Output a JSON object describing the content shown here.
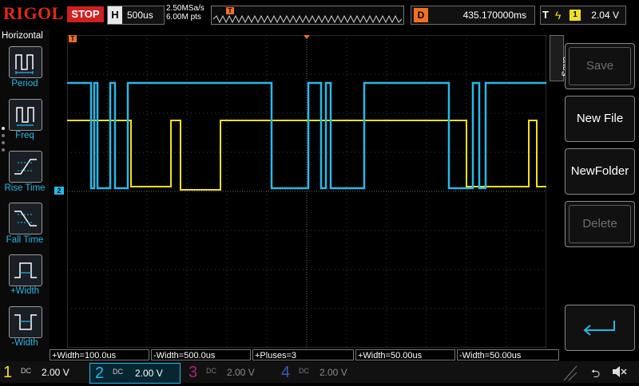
{
  "header": {
    "brand": "RIGOL",
    "run_state": "STOP",
    "timebase_label": "H",
    "timebase_value": "500us",
    "sample_rate": "2.50MSa/s",
    "memory_depth": "6.00M pts",
    "trigger_position_label": "T",
    "delay_label": "D",
    "delay_value": "435.170000ms",
    "trigger_label": "T",
    "trigger_source": "1",
    "trigger_level": "2.04 V"
  },
  "measure_panel": {
    "title": "Horizontal",
    "items": [
      {
        "label": "Period",
        "icon": "period-icon"
      },
      {
        "label": "Freq",
        "icon": "frequency-icon"
      },
      {
        "label": "Rise Time",
        "icon": "rise-time-icon"
      },
      {
        "label": "Fall Time",
        "icon": "fall-time-icon"
      },
      {
        "label": "+Width",
        "icon": "positive-width-icon"
      },
      {
        "label": "-Width",
        "icon": "negative-width-icon"
      }
    ]
  },
  "save_menu": {
    "tab": "Save",
    "buttons": [
      {
        "label": "Save",
        "enabled": false
      },
      {
        "label": "New File",
        "enabled": true
      },
      {
        "label": "NewFolder",
        "enabled": true
      },
      {
        "label": "Delete",
        "enabled": false
      },
      {
        "label": "",
        "icon": "return-icon",
        "enabled": true
      }
    ]
  },
  "measurements": [
    "+Width=100.0us",
    "-Width=500.0us",
    "+Pluses=3",
    "+Width=50.00us",
    "-Width=50.00us"
  ],
  "markers": {
    "ch2_ground": "2"
  },
  "channels": [
    {
      "num": "1",
      "coupling": "DC",
      "scale": "2.00 V",
      "color": "#f2e020",
      "active": false
    },
    {
      "num": "2",
      "coupling": "DC",
      "scale": "2.00 V",
      "color": "#29b8e8",
      "active": true
    },
    {
      "num": "3",
      "coupling": "DC",
      "scale": "2.00 V",
      "color": "#b0217a",
      "active": false
    },
    {
      "num": "4",
      "coupling": "DC",
      "scale": "2.00 V",
      "color": "#3a5bb8",
      "active": false
    }
  ],
  "colors": {
    "ch1": "#f2e020",
    "ch2": "#29b8e8",
    "trigger": "#f07020",
    "brand": "#e0281e"
  }
}
